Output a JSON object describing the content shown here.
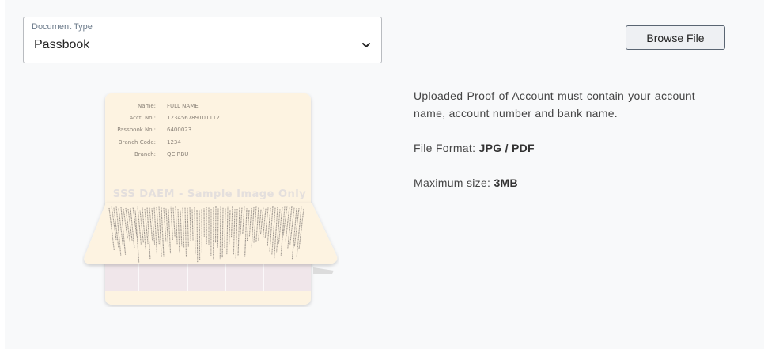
{
  "document_type": {
    "label": "Document Type",
    "value": "Passbook"
  },
  "browse_button": {
    "label": "Browse File"
  },
  "info": {
    "requirement": "Uploaded Proof of Account must contain your account name, account number and bank name.",
    "file_format_label": "File Format:",
    "file_format_value": "JPG / PDF",
    "max_size_label": "Maximum size:",
    "max_size_value": "3MB"
  },
  "sample_passbook": {
    "fields": [
      {
        "label": "Name:",
        "value": "FULL NAME"
      },
      {
        "label": "Acct. No.:",
        "value": "123456789101112"
      },
      {
        "label": "Passbook No.:",
        "value": "6400023"
      },
      {
        "label": "Branch Code:",
        "value": "1234"
      },
      {
        "label": "Branch:",
        "value": "QC RBU"
      }
    ],
    "watermark": "SSS DAEM - Sample Image Only"
  },
  "colors": {
    "paper": "#fdf3e1",
    "lower_page": "#f0e6ea",
    "button_border": "#5a6572"
  }
}
